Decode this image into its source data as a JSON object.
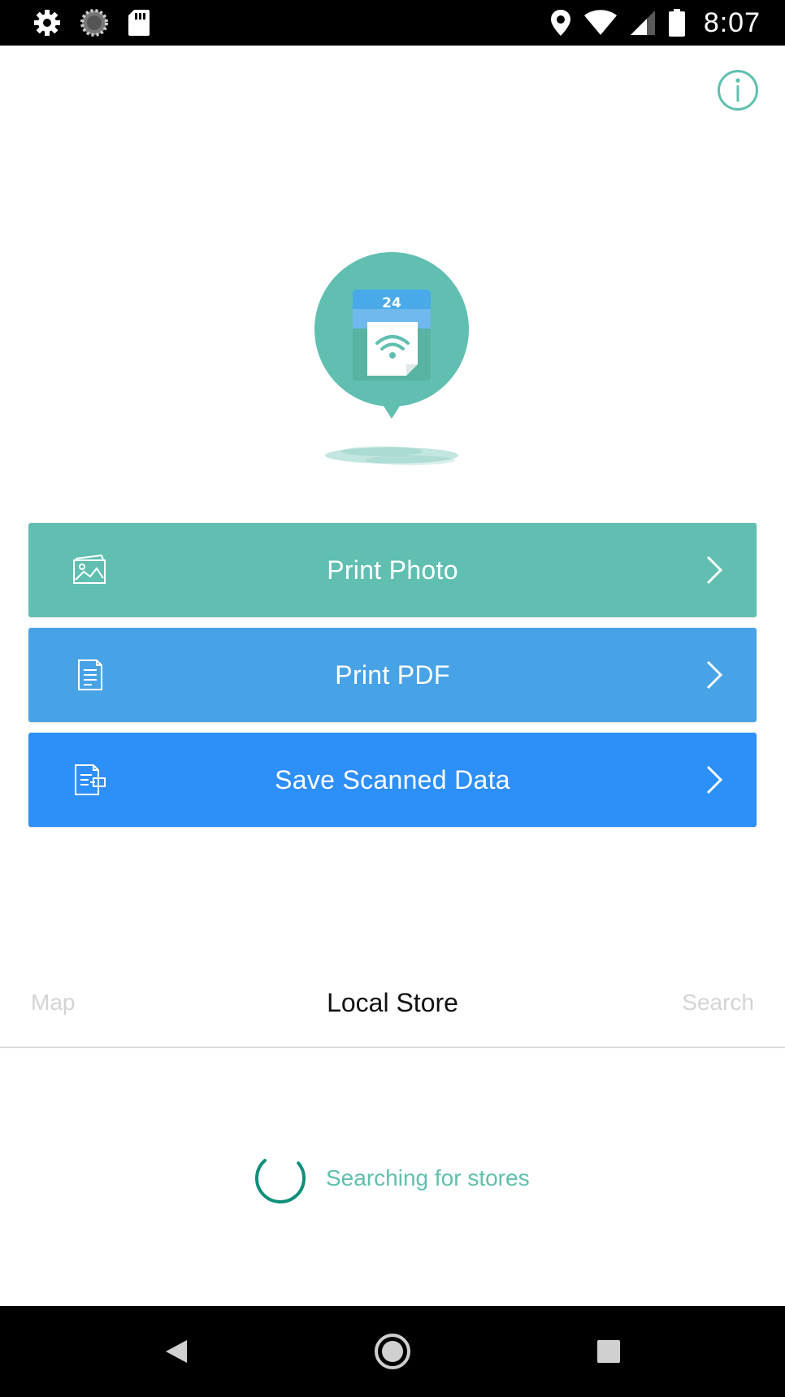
{
  "status_bar": {
    "time": "8:07",
    "left_icons": [
      "settings-icon",
      "sync-icon",
      "sd-card-icon"
    ],
    "right_icons": [
      "location-icon",
      "wifi-icon",
      "signal-icon",
      "battery-icon"
    ]
  },
  "header": {
    "info_icon": "info-icon",
    "info_glyph": "i"
  },
  "hero": {
    "calendar_number": "24",
    "colors": {
      "bubble": "#60bfb1",
      "header": "#4aa9e8",
      "paper": "#ffffff"
    }
  },
  "actions": [
    {
      "label": "Print Photo",
      "icon": "photo-icon",
      "color": "#60bfb1"
    },
    {
      "label": "Print PDF",
      "icon": "document-icon",
      "color": "#48a3e6"
    },
    {
      "label": "Save Scanned Data",
      "icon": "scan-save-icon",
      "color": "#2d8ff8"
    }
  ],
  "tabs": {
    "map": "Map",
    "local_store": "Local Store",
    "search": "Search",
    "active": "Local Store"
  },
  "loading": {
    "text": "Searching for stores"
  },
  "nav_bar": {
    "buttons": [
      "back-icon",
      "home-icon",
      "recents-icon"
    ]
  },
  "colors": {
    "accent": "#5fc0ae",
    "inactive_tab": "#d4d4d4"
  }
}
